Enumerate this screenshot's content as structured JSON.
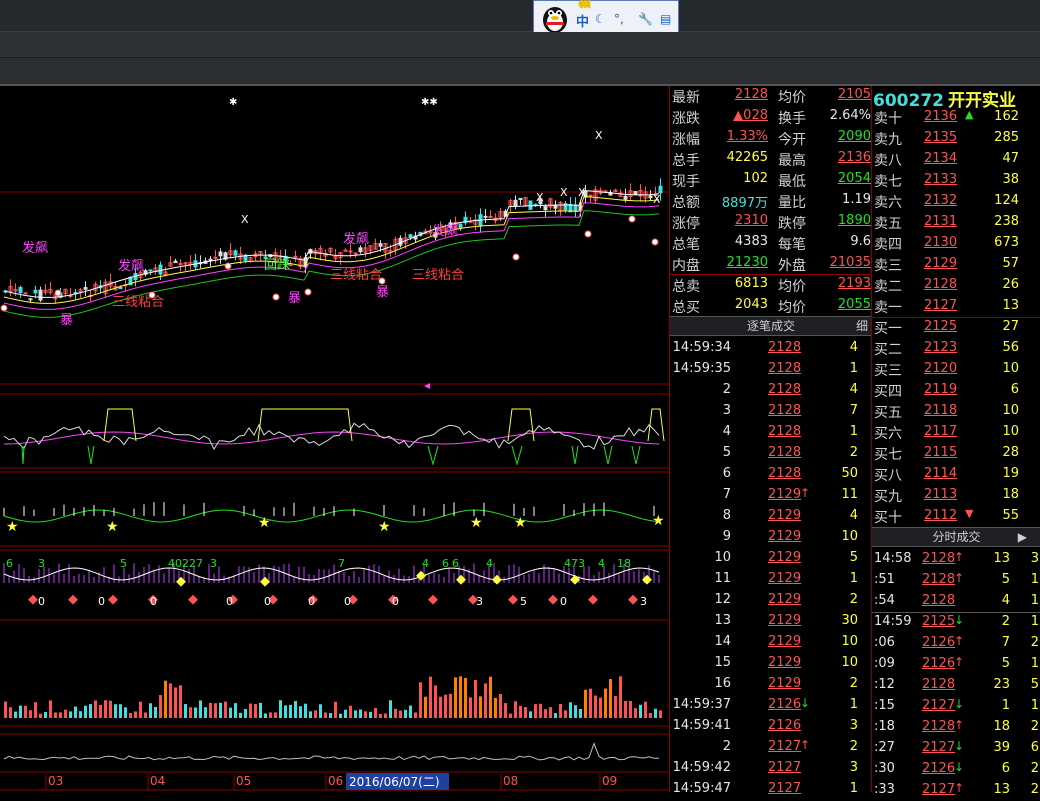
{
  "ime": {
    "mode": "中",
    "icons": [
      "moon-icon",
      "punct-icon",
      "wrench-icon",
      "tool-icon"
    ]
  },
  "chart": {
    "annotations_main": [
      "发飙",
      "发飙",
      "发飙",
      "发飙",
      "三线粘合",
      "三线粘合",
      "三线粘合",
      "暴",
      "暴",
      "暴",
      "回踩"
    ],
    "x_marks": [
      "X",
      "X",
      "X",
      "X",
      "X",
      "X"
    ],
    "bottom_axis": [
      "03",
      "04",
      "05",
      "06",
      "08",
      "09"
    ],
    "date_label": "2016/06/07(二)",
    "row3_numbers": [
      "6",
      "3",
      "5",
      "40227",
      "3",
      "7",
      "4",
      "6",
      "6",
      "4",
      "473",
      "4",
      "18",
      "12"
    ],
    "row3_bottom": [
      "0",
      "0",
      "0",
      "0",
      "0",
      "0",
      "0",
      "0",
      "3",
      "5",
      "0",
      "3",
      "0",
      "0",
      "0",
      "6"
    ]
  },
  "quote": {
    "rows": [
      {
        "l": "最新",
        "v": "2128",
        "vc": "red",
        "l2": "均价",
        "v2": "2105",
        "v2c": "red"
      },
      {
        "l": "涨跌",
        "v": "▲028",
        "vc": "red",
        "l2": "换手",
        "v2": "2.64%",
        "v2c": "wht"
      },
      {
        "l": "涨幅",
        "v": "1.33%",
        "vc": "red",
        "l2": "今开",
        "v2": "2090",
        "v2c": "grn"
      },
      {
        "l": "总手",
        "v": "42265",
        "vc": "yel",
        "l2": "最高",
        "v2": "2136",
        "v2c": "red"
      },
      {
        "l": "现手",
        "v": "102",
        "vc": "yel",
        "l2": "最低",
        "v2": "2054",
        "v2c": "grn"
      },
      {
        "l": "总额",
        "v": "8897万",
        "vc": "cyn",
        "l2": "量比",
        "v2": "1.19",
        "v2c": "wht"
      },
      {
        "l": "涨停",
        "v": "2310",
        "vc": "red",
        "l2": "跌停",
        "v2": "1890",
        "v2c": "grn"
      },
      {
        "l": "总笔",
        "v": "4383",
        "vc": "wht",
        "l2": "每笔",
        "v2": "9.6",
        "v2c": "wht"
      },
      {
        "l": "内盘",
        "v": "21230",
        "vc": "grn",
        "l2": "外盘",
        "v2": "21035",
        "v2c": "red"
      },
      {
        "l": "总卖",
        "v": "6813",
        "vc": "yel",
        "l2": "均价",
        "v2": "2193",
        "v2c": "red"
      },
      {
        "l": "总买",
        "v": "2043",
        "vc": "yel",
        "l2": "均价",
        "v2": "2055",
        "v2c": "grn"
      }
    ],
    "tick_header": "逐笔成交",
    "tick_detail": "细",
    "ticks": [
      {
        "t": "14:59:34",
        "p": "2128",
        "a": "",
        "n": "4"
      },
      {
        "t": "14:59:35",
        "p": "2128",
        "a": "",
        "n": "1"
      },
      {
        "t": "2",
        "p": "2128",
        "a": "",
        "n": "4"
      },
      {
        "t": "3",
        "p": "2128",
        "a": "",
        "n": "7"
      },
      {
        "t": "4",
        "p": "2128",
        "a": "",
        "n": "1"
      },
      {
        "t": "5",
        "p": "2128",
        "a": "",
        "n": "2"
      },
      {
        "t": "6",
        "p": "2128",
        "a": "",
        "n": "50"
      },
      {
        "t": "7",
        "p": "2129",
        "a": "↑",
        "n": "11"
      },
      {
        "t": "8",
        "p": "2129",
        "a": "",
        "n": "4"
      },
      {
        "t": "9",
        "p": "2129",
        "a": "",
        "n": "10"
      },
      {
        "t": "10",
        "p": "2129",
        "a": "",
        "n": "5"
      },
      {
        "t": "11",
        "p": "2129",
        "a": "",
        "n": "1"
      },
      {
        "t": "12",
        "p": "2129",
        "a": "",
        "n": "2"
      },
      {
        "t": "13",
        "p": "2129",
        "a": "",
        "n": "30"
      },
      {
        "t": "14",
        "p": "2129",
        "a": "",
        "n": "10"
      },
      {
        "t": "15",
        "p": "2129",
        "a": "",
        "n": "10"
      },
      {
        "t": "16",
        "p": "2129",
        "a": "",
        "n": "2"
      },
      {
        "t": "14:59:37",
        "p": "2126",
        "a": "↓",
        "n": "1"
      },
      {
        "t": "14:59:41",
        "p": "2126",
        "a": "",
        "n": "3"
      },
      {
        "t": "2",
        "p": "2127",
        "a": "↑",
        "n": "2"
      },
      {
        "t": "14:59:42",
        "p": "2127",
        "a": "",
        "n": "3"
      },
      {
        "t": "14:59:47",
        "p": "2127",
        "a": "",
        "n": "1"
      }
    ]
  },
  "book": {
    "code": "600272",
    "name": "开开实业",
    "sells": [
      {
        "l": "卖十",
        "p": "2136",
        "a": "▲",
        "n": "162"
      },
      {
        "l": "卖九",
        "p": "2135",
        "a": "",
        "n": "285"
      },
      {
        "l": "卖八",
        "p": "2134",
        "a": "",
        "n": "47"
      },
      {
        "l": "卖七",
        "p": "2133",
        "a": "",
        "n": "38"
      },
      {
        "l": "卖六",
        "p": "2132",
        "a": "",
        "n": "124"
      },
      {
        "l": "卖五",
        "p": "2131",
        "a": "",
        "n": "238"
      },
      {
        "l": "卖四",
        "p": "2130",
        "a": "",
        "n": "673"
      },
      {
        "l": "卖三",
        "p": "2129",
        "a": "",
        "n": "57"
      },
      {
        "l": "卖二",
        "p": "2128",
        "a": "",
        "n": "26"
      },
      {
        "l": "卖一",
        "p": "2127",
        "a": "",
        "n": "13"
      }
    ],
    "buys": [
      {
        "l": "买一",
        "p": "2125",
        "a": "",
        "n": "27"
      },
      {
        "l": "买二",
        "p": "2123",
        "a": "",
        "n": "56"
      },
      {
        "l": "买三",
        "p": "2120",
        "a": "",
        "n": "10"
      },
      {
        "l": "买四",
        "p": "2119",
        "a": "",
        "n": "6"
      },
      {
        "l": "买五",
        "p": "2118",
        "a": "",
        "n": "10"
      },
      {
        "l": "买六",
        "p": "2117",
        "a": "",
        "n": "10"
      },
      {
        "l": "买七",
        "p": "2115",
        "a": "",
        "n": "28"
      },
      {
        "l": "买八",
        "p": "2114",
        "a": "",
        "n": "19"
      },
      {
        "l": "买九",
        "p": "2113",
        "a": "",
        "n": "18"
      },
      {
        "l": "买十",
        "p": "2112",
        "a": "▼",
        "n": "55"
      }
    ],
    "minute_header": "分时成交",
    "minute_next": "▶",
    "minutes": [
      {
        "t": "14:58",
        "p": "2128",
        "a": "↑",
        "n": "13",
        "n2": "3"
      },
      {
        "t": ":51",
        "p": "2128",
        "a": "↑",
        "n": "5",
        "n2": "1"
      },
      {
        "t": ":54",
        "p": "2128",
        "a": "",
        "n": "4",
        "n2": "1"
      },
      {
        "t": "14:59",
        "p": "2125",
        "a": "↓",
        "n": "2",
        "n2": "1"
      },
      {
        "t": ":06",
        "p": "2126",
        "a": "↑",
        "n": "7",
        "n2": "2"
      },
      {
        "t": ":09",
        "p": "2126",
        "a": "↑",
        "n": "5",
        "n2": "1"
      },
      {
        "t": ":12",
        "p": "2128",
        "a": "",
        "n": "23",
        "n2": "5"
      },
      {
        "t": ":15",
        "p": "2127",
        "a": "↓",
        "n": "1",
        "n2": "1"
      },
      {
        "t": ":18",
        "p": "2128",
        "a": "↑",
        "n": "18",
        "n2": "2"
      },
      {
        "t": ":27",
        "p": "2127",
        "a": "↓",
        "n": "39",
        "n2": "6"
      },
      {
        "t": ":30",
        "p": "2126",
        "a": "↓",
        "n": "6",
        "n2": "2"
      },
      {
        "t": ":33",
        "p": "2127",
        "a": "↑",
        "n": "13",
        "n2": "2"
      }
    ]
  },
  "colors": {
    "up": "#ff5353",
    "down": "#20e020",
    "vol": "#ffff40",
    "accent": "#40e0e0"
  }
}
